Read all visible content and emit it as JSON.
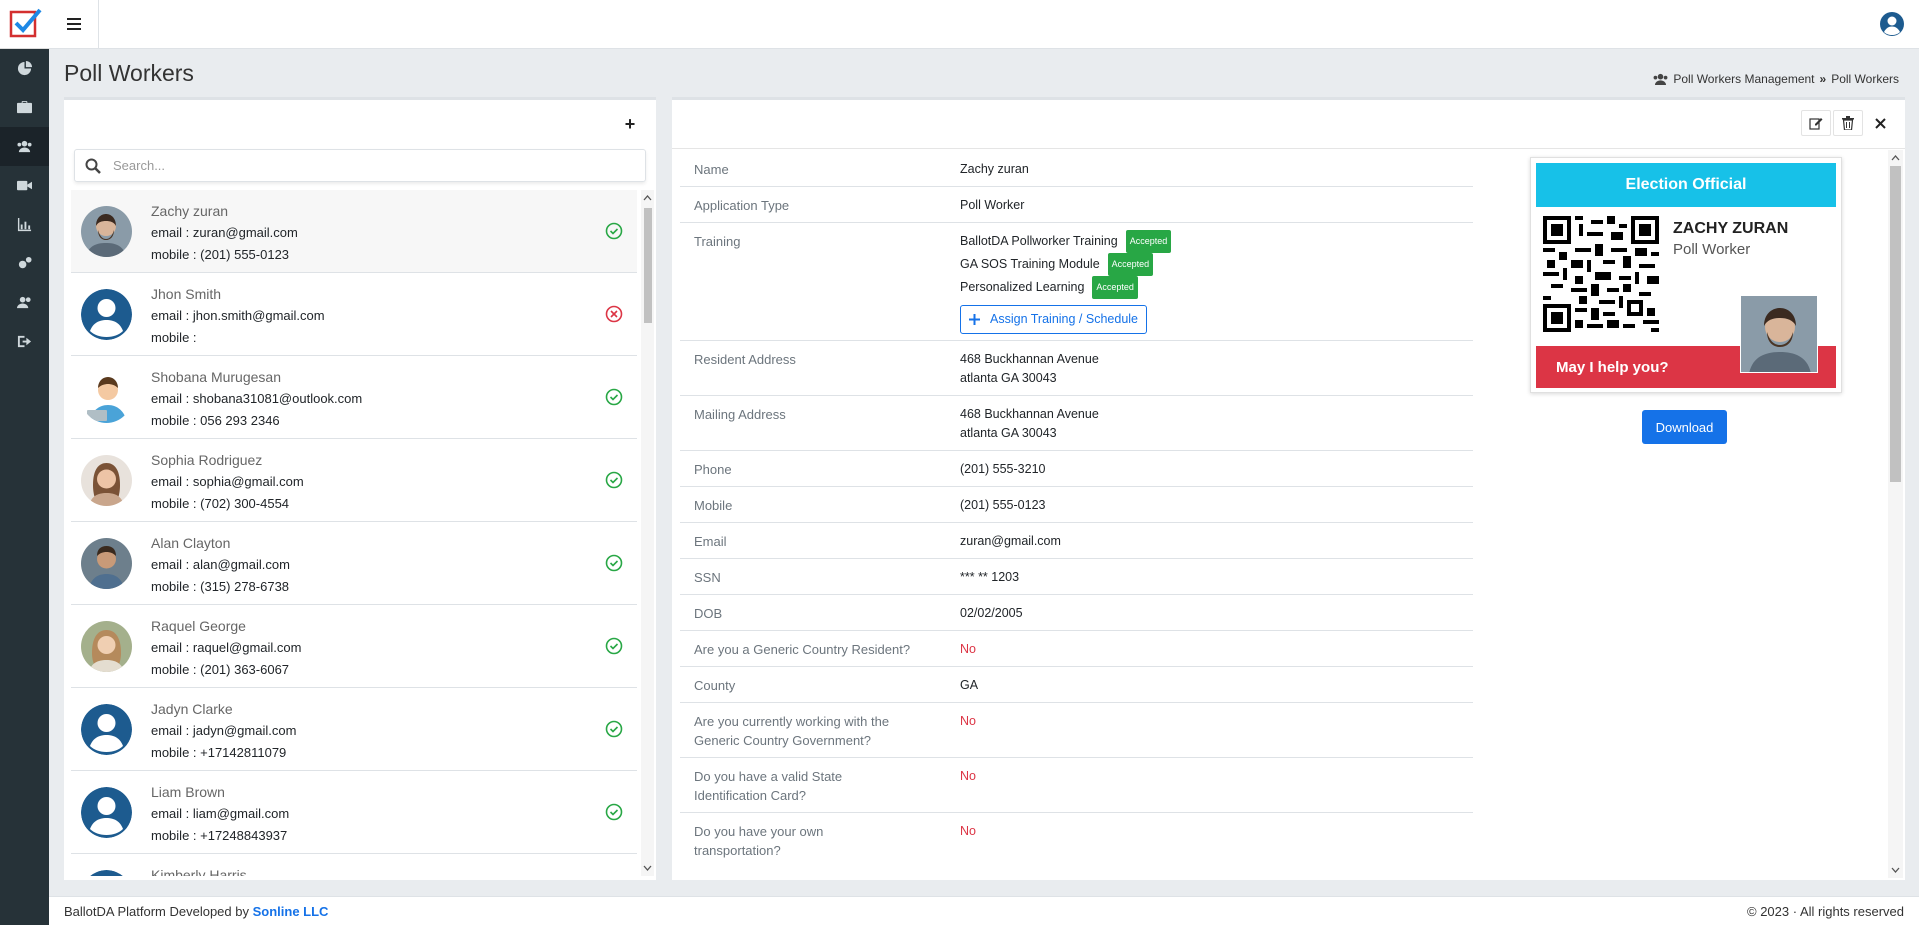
{
  "page": {
    "title": "Poll Workers"
  },
  "breadcrumb": {
    "parent": "Poll Workers Management",
    "current": "Poll Workers"
  },
  "search": {
    "placeholder": "Search..."
  },
  "workers": [
    {
      "name": "Zachy zuran",
      "email": "email : zuran@gmail.com",
      "mobile": "mobile : (201) 555-0123",
      "status": "accepted",
      "avatar": "photo-man-beard"
    },
    {
      "name": "Jhon Smith",
      "email": "email : jhon.smith@gmail.com",
      "mobile": "mobile :",
      "status": "rejected",
      "avatar": "default-user"
    },
    {
      "name": "Shobana Murugesan",
      "email": "email : shobana31081@outlook.com",
      "mobile": "mobile : 056 293 2346",
      "status": "accepted",
      "avatar": "cartoon"
    },
    {
      "name": "Sophia Rodriguez",
      "email": "email : sophia@gmail.com",
      "mobile": "mobile : (702) 300-4554",
      "status": "accepted",
      "avatar": "photo-woman-glasses"
    },
    {
      "name": "Alan Clayton",
      "email": "email : alan@gmail.com",
      "mobile": "mobile : (315) 278-6738",
      "status": "accepted",
      "avatar": "photo-man"
    },
    {
      "name": "Raquel George",
      "email": "email : raquel@gmail.com",
      "mobile": "mobile : (201) 363-6067",
      "status": "accepted",
      "avatar": "photo-woman"
    },
    {
      "name": "Jadyn Clarke",
      "email": "email : jadyn@gmail.com",
      "mobile": "mobile : +17142811079",
      "status": "accepted",
      "avatar": "default-user"
    },
    {
      "name": "Liam Brown",
      "email": "email : liam@gmail.com",
      "mobile": "mobile : +17248843937",
      "status": "accepted",
      "avatar": "default-user"
    },
    {
      "name": "Kimberly Harris",
      "email": "",
      "mobile": "",
      "status": "",
      "avatar": "default-user"
    }
  ],
  "details": {
    "name": {
      "label": "Name",
      "value": "Zachy zuran"
    },
    "application_type": {
      "label": "Application Type",
      "value": "Poll Worker"
    },
    "training": {
      "label": "Training",
      "items": [
        {
          "name": "BallotDA Pollworker Training",
          "status": "Accepted"
        },
        {
          "name": "GA SOS Training Module",
          "status": "Accepted"
        },
        {
          "name": "Personalized Learning",
          "status": "Accepted"
        }
      ],
      "assign_label": "Assign Training / Schedule"
    },
    "resident_address": {
      "label": "Resident Address",
      "line1": "468 Buckhannan Avenue",
      "line2": "atlanta GA 30043"
    },
    "mailing_address": {
      "label": "Mailing Address",
      "line1": "468 Buckhannan Avenue",
      "line2": "atlanta GA 30043"
    },
    "phone": {
      "label": "Phone",
      "value": "(201) 555-3210"
    },
    "mobile": {
      "label": "Mobile",
      "value": "(201) 555-0123"
    },
    "email": {
      "label": "Email",
      "value": "zuran@gmail.com"
    },
    "ssn": {
      "label": "SSN",
      "value": "*** ** 1203"
    },
    "dob": {
      "label": "DOB",
      "value": "02/02/2005"
    },
    "resident_q": {
      "label": "Are you a Generic Country Resident?",
      "value": "No"
    },
    "county": {
      "label": "County",
      "value": "GA"
    },
    "gov_q": {
      "label": "Are you currently working with the Generic Country Government?",
      "value": "No"
    },
    "id_q": {
      "label": "Do you have a valid State Identification Card?",
      "value": "No"
    },
    "transport_q": {
      "label": "Do you have your own transportation?",
      "value": "No"
    }
  },
  "id_card": {
    "header": "Election Official",
    "name": "ZACHY ZURAN",
    "role": "Poll Worker",
    "footer": "May I help you?",
    "header_color": "#17c1e8",
    "footer_color": "#dc3545"
  },
  "download_label": "Download",
  "footer": {
    "text": "BallotDA Platform Developed by",
    "company": "Sonline LLC",
    "copyright": "© 2023 · All rights reserved"
  },
  "colors": {
    "primary": "#1572e8",
    "success": "#28a745",
    "danger": "#dc3545",
    "sidebar": "#263238"
  }
}
